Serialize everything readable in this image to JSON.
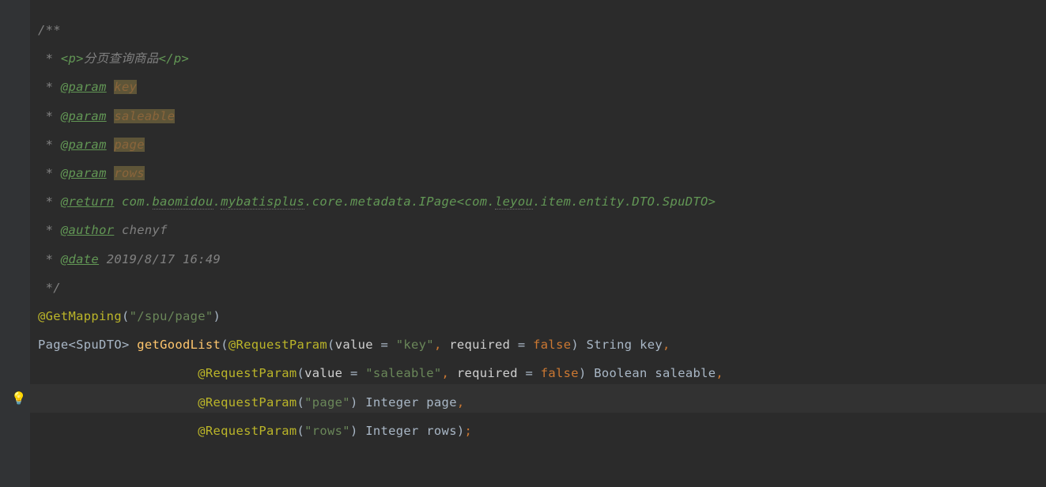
{
  "doc": {
    "open": "/**",
    "desc_prefix": " * ",
    "desc_tag_open": "<p>",
    "desc_text": "分页查询商品",
    "desc_tag_close": "</p>",
    "tag_param": "@param",
    "p1": "key",
    "p2": "saleable",
    "p3": "page",
    "p4": "rows",
    "tag_return": "@return",
    "ret_pre": " com.",
    "ret_typo1": "baomidou",
    "ret_dot1": ".",
    "ret_typo2": "mybatisplus",
    "ret_mid": ".core.metadata.IPage<com.",
    "ret_typo3": "leyou",
    "ret_post": ".item.entity.DTO.SpuDTO>",
    "tag_author": "@author",
    "author_val": " chenyf",
    "tag_date": "@date",
    "date_val": " 2019/8/17 16:49",
    "close": " */"
  },
  "code": {
    "ann_get": "@GetMapping",
    "get_path": "\"/spu/page\"",
    "ret_type_pre": "Page",
    "ret_gen": "<SpuDTO>",
    "method": "getGoodList",
    "ann_rp": "@RequestParam",
    "attr_value": "value",
    "attr_required": "required",
    "str_key": "\"key\"",
    "str_saleable": "\"saleable\"",
    "str_page": "\"page\"",
    "str_rows": "\"rows\"",
    "kw_false": "false",
    "t_string": "String",
    "t_boolean": "Boolean",
    "t_integer": "Integer",
    "id_key": "key",
    "id_saleable": "saleable",
    "id_page": "page",
    "id_rows": "rows"
  },
  "icons": {
    "bulb": "💡"
  }
}
